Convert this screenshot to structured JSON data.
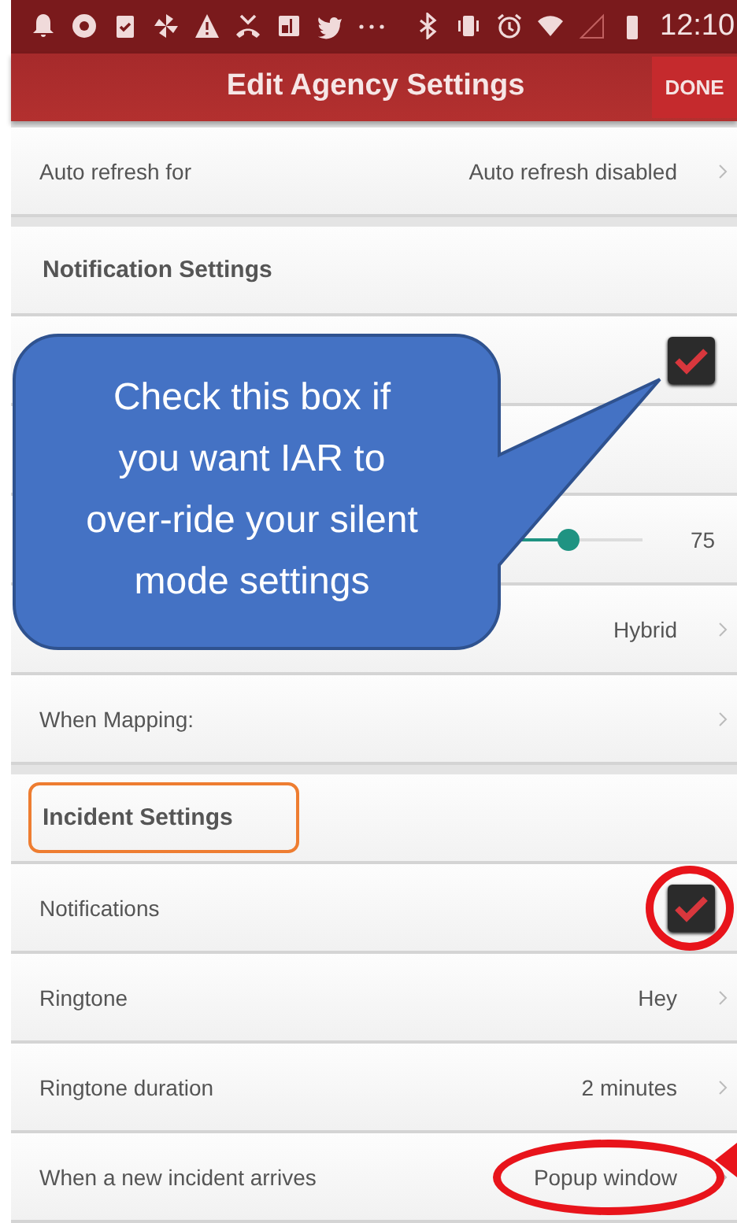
{
  "status_bar": {
    "time": "12:10"
  },
  "toolbar": {
    "title": "Edit Agency Settings",
    "done_button": "DONE"
  },
  "sections": [
    {
      "rows": [
        {
          "kind": "link",
          "label": "Auto refresh for",
          "value": "Auto refresh disabled"
        }
      ]
    },
    {
      "header": "Notification Settings",
      "header_highlighted": false,
      "rows": [
        {
          "kind": "checkbox",
          "checked": true
        },
        {
          "kind": "blank"
        },
        {
          "kind": "slider",
          "level": 0.75,
          "reading": "75"
        },
        {
          "kind": "link",
          "value": "Hybrid"
        },
        {
          "kind": "link",
          "label": "When Mapping:"
        }
      ]
    },
    {
      "header": "Incident Settings",
      "header_highlighted": true,
      "rows": [
        {
          "kind": "checkbox",
          "label": "Notifications",
          "checked": true,
          "circled": true
        },
        {
          "kind": "link",
          "label": "Ringtone",
          "value": "Hey"
        },
        {
          "kind": "link",
          "label": "Ringtone duration",
          "value": "2 minutes"
        },
        {
          "kind": "link",
          "label": "When a new incident arrives",
          "value": "Popup window",
          "circled": true
        }
      ]
    }
  ],
  "callout": {
    "lines": [
      "Check this box if",
      "you want IAR to",
      "over-ride your silent",
      "mode settings"
    ]
  }
}
